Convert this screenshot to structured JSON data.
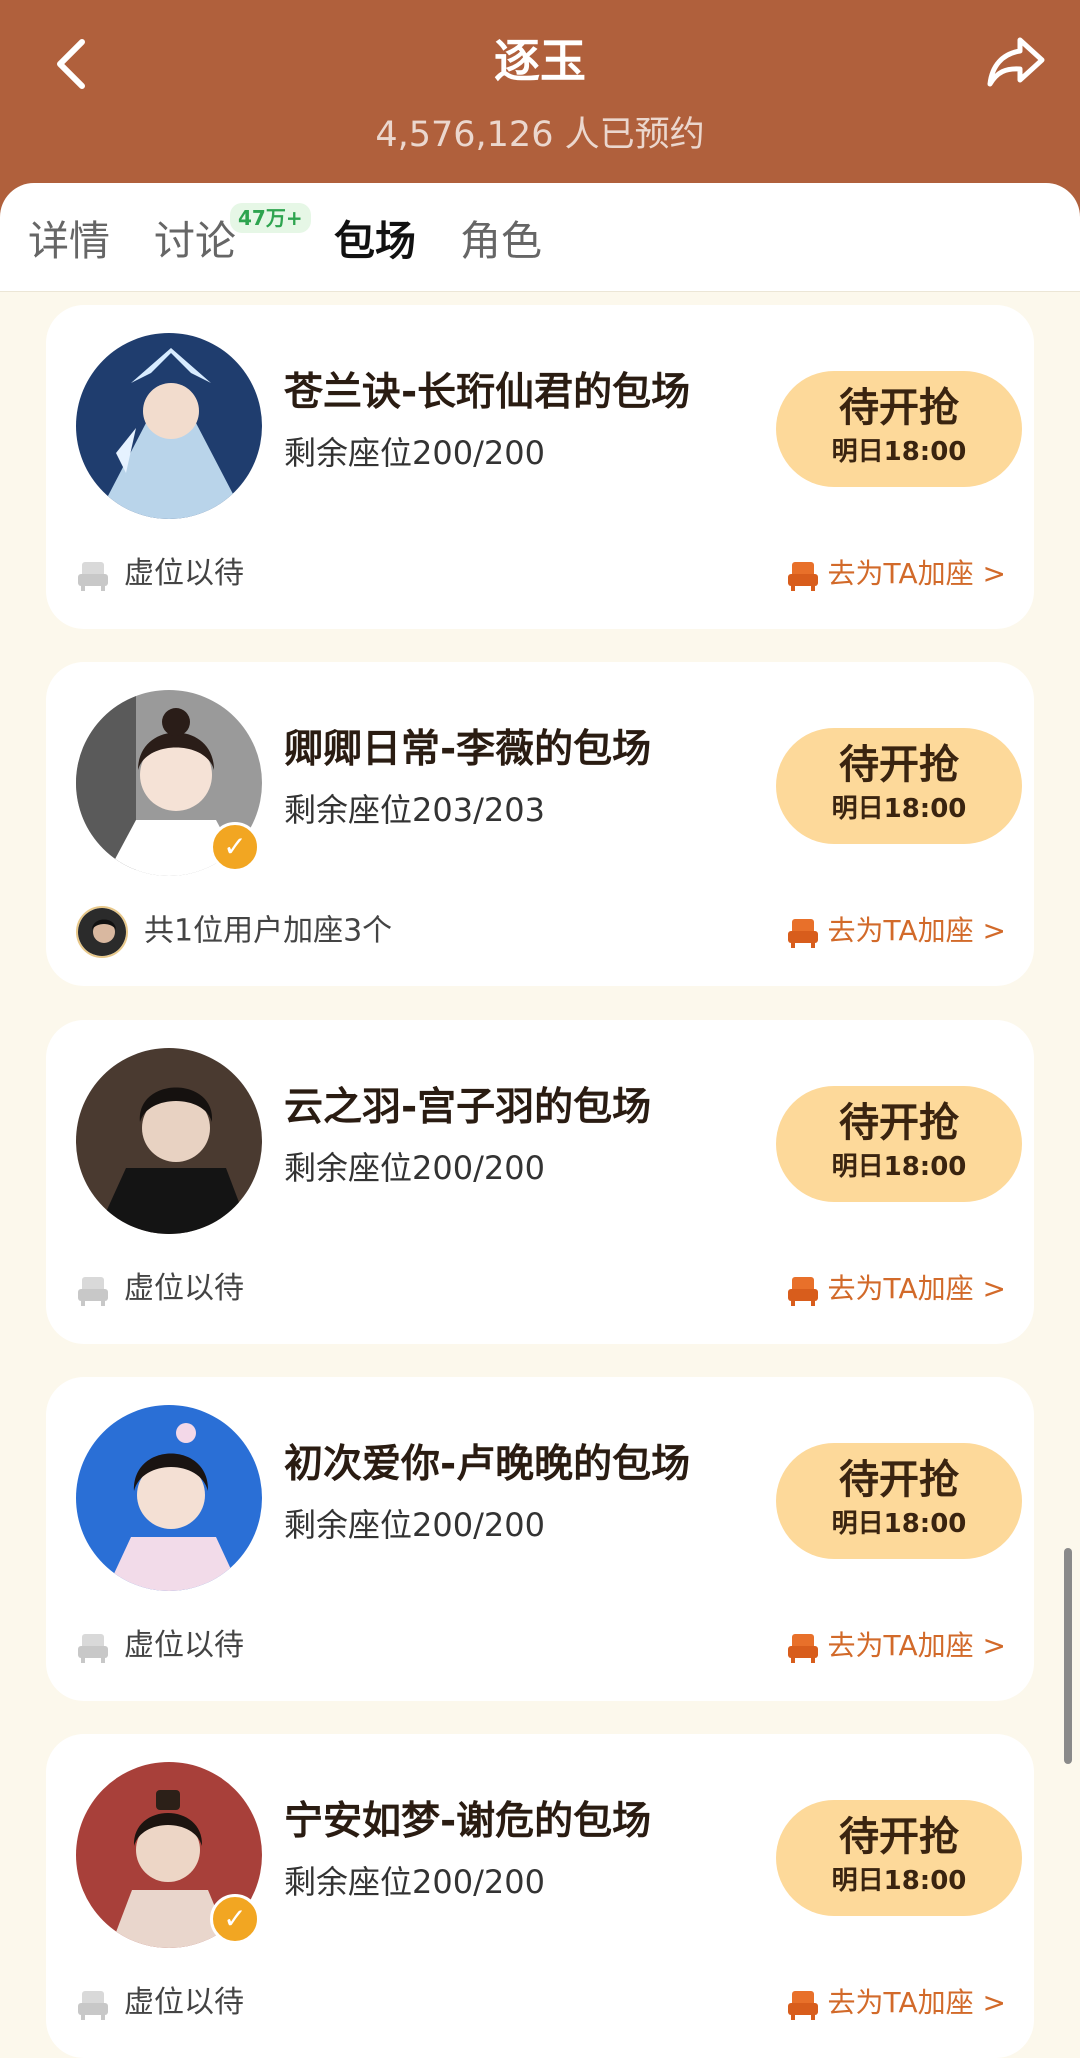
{
  "header": {
    "title": "逐玉",
    "reservations": "4,576,126",
    "reservations_suffix": "人已预约"
  },
  "tabs": [
    {
      "label": "详情"
    },
    {
      "label": "讨论",
      "badge": "47万+"
    },
    {
      "label": "包场"
    },
    {
      "label": "角色"
    }
  ],
  "active_tab": "包场",
  "cards": [
    {
      "title": "苍兰诀-长珩仙君的包场",
      "seats": "剩余座位200/200",
      "button": "待开抢",
      "time": "明日18:00",
      "footer": "虚位以待",
      "link": "去为TA加座 >"
    },
    {
      "title": "卿卿日常-李薇的包场",
      "seats": "剩余座位203/203",
      "button": "待开抢",
      "time": "明日18:00",
      "footer": "共1位用户加座3个",
      "link": "去为TA加座 >"
    },
    {
      "title": "云之羽-宫子羽的包场",
      "seats": "剩余座位200/200",
      "button": "待开抢",
      "time": "明日18:00",
      "footer": "虚位以待",
      "link": "去为TA加座 >"
    },
    {
      "title": "初次爱你-卢晚晚的包场",
      "seats": "剩余座位200/200",
      "button": "待开抢",
      "time": "明日18:00",
      "footer": "虚位以待",
      "link": "去为TA加座 >"
    },
    {
      "title": "宁安如梦-谢危的包场",
      "seats": "剩余座位200/200",
      "button": "待开抢",
      "time": "明日18:00",
      "footer": "虚位以待",
      "link": "去为TA加座 >"
    }
  ],
  "colors": {
    "header_bg": "#b0603c",
    "page_bg": "#fcf8ec",
    "button_bg": "#fdd99a",
    "link_color": "#d26a2a",
    "badge_color": "#2ea44f",
    "verified_badge": "#f2a622"
  }
}
